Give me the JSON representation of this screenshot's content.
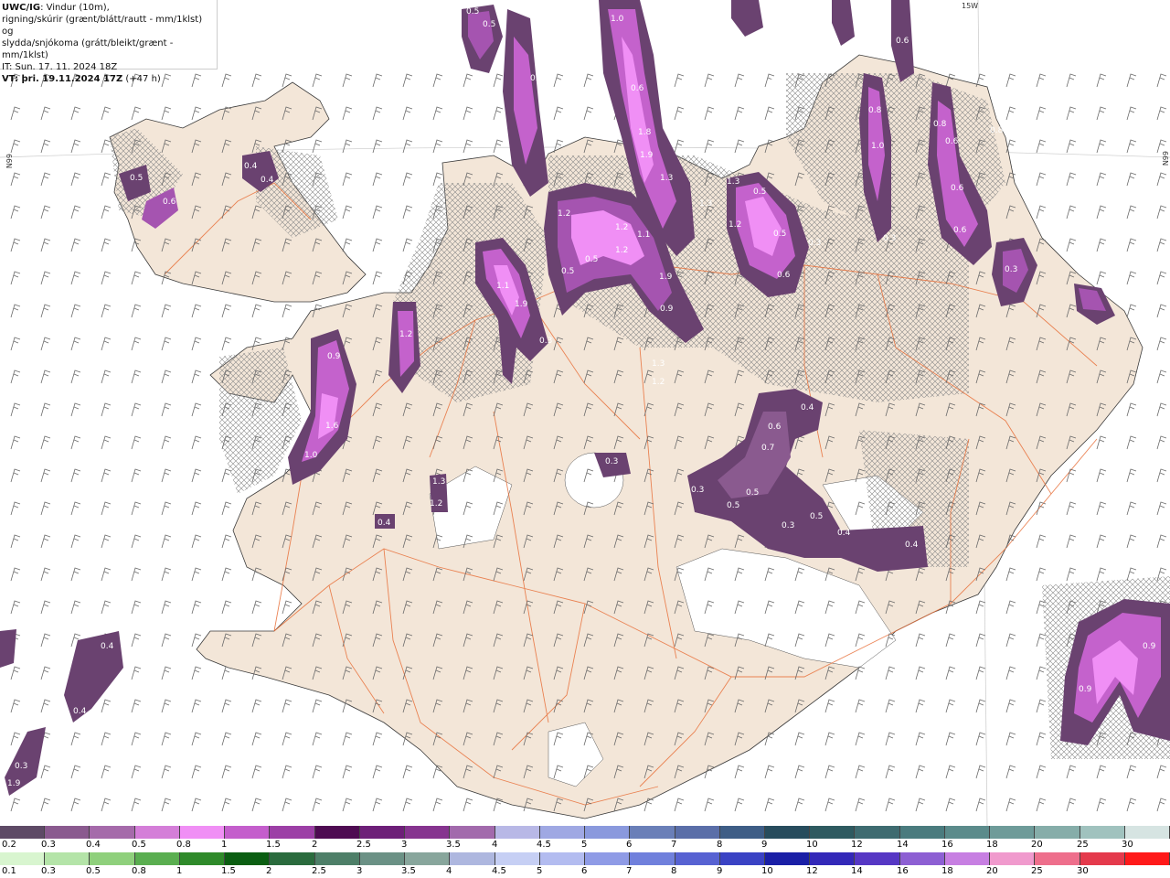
{
  "header": {
    "model": "UWC/IG",
    "line1_rest": ": Vindur (10m),",
    "line2": "rigning/skúrir (grænt/blátt/rautt - mm/1klst) og",
    "line3": "slydda/snjókoma (grátt/bleikt/grænt - mm/1klst)",
    "init": "IT: Sun. 17. 11. 2024 18Z",
    "valid": "VT: þri. 19.11.2024 17Z",
    "lead": "(+47 h)"
  },
  "map": {
    "edge_labels": {
      "top_lon": "15W",
      "left_lat": "66N",
      "right_lat": "66N"
    },
    "precip_values": [
      "0.5",
      "0.5",
      "1.0",
      "0.6",
      "0.4",
      "0.4",
      "0.6",
      "0.5",
      "0.6",
      "0.4",
      "0.4",
      "0.6",
      "0.8",
      "1.8",
      "1.9",
      "1.3",
      "1.3",
      "1.3",
      "0.5",
      "1.2",
      "0.5",
      "0.3",
      "0.6",
      "1.0",
      "0.8",
      "0.6",
      "0.8",
      "0.6",
      "0.3",
      "0.3",
      "0.6",
      "1.2",
      "1.1",
      "1.2",
      "0.5",
      "1.2",
      "0.5",
      "1.1",
      "1.9",
      "0.3",
      "1.9",
      "0.9",
      "1.2",
      "1.3",
      "1.2",
      "0.9",
      "1.6",
      "1.0",
      "1.3",
      "1.2",
      "0.4",
      "0.3",
      "0.4",
      "0.6",
      "0.7",
      "0.3",
      "0.5",
      "0.5",
      "0.3",
      "0.5",
      "0.4",
      "0.4",
      "0.4",
      "0.4",
      "0.3",
      "1.9",
      "0.9",
      "0.9"
    ],
    "colors": {
      "land": "#f3e6d8",
      "sea": "#ffffff",
      "roads": "#e8703a",
      "glacier": "#ffffff",
      "snow_hatch": "#8a8a8a"
    }
  },
  "legend": {
    "snow_labels": [
      "0.2",
      "0.3",
      "0.4",
      "0.5",
      "0.8",
      "1",
      "1.5",
      "2",
      "2.5",
      "3",
      "3.5",
      "4",
      "4.5",
      "5",
      "6",
      "7",
      "8",
      "9",
      "10",
      "12",
      "14",
      "16",
      "18",
      "20",
      "25",
      "30"
    ],
    "snow_colors": [
      "#5e4a66",
      "#8a5a8f",
      "#a56aaa",
      "#d47ed8",
      "#f08ff5",
      "#c45ecc",
      "#9c3fa6",
      "#4e0b52",
      "#6d1f78",
      "#86348f",
      "#a26aac",
      "#b8b8e6",
      "#9fa8e3",
      "#8a99dd",
      "#6a7fb8",
      "#5a6ea8",
      "#3e5d86",
      "#274c5d",
      "#2e5a60",
      "#3e6b70",
      "#4a7b7e",
      "#5b8b8b",
      "#6e9b99",
      "#86ada9",
      "#a0c2be",
      "#d6e4e2"
    ],
    "rain_labels": [
      "0.1",
      "0.3",
      "0.5",
      "0.8",
      "1",
      "1.5",
      "2",
      "2.5",
      "3",
      "3.5",
      "4",
      "4.5",
      "5",
      "6",
      "7",
      "8",
      "9",
      "10",
      "12",
      "14",
      "16",
      "18",
      "20",
      "25",
      "30"
    ],
    "rain_colors": [
      "#d8f5cf",
      "#b4e4a8",
      "#8fd07c",
      "#5aae50",
      "#2f8a2a",
      "#0b5e12",
      "#2a6b3d",
      "#4e7f68",
      "#6b9185",
      "#88a69c",
      "#aeb7df",
      "#c6cff4",
      "#b3bcf0",
      "#8f9be6",
      "#7080dc",
      "#5762d2",
      "#3a42c4",
      "#1a1fa6",
      "#3328b8",
      "#5637c4",
      "#8d5fd3",
      "#c77fe2",
      "#f09acd",
      "#ee6f8c",
      "#e43a4c"
    ],
    "rain_extra": "#ff1a1a"
  }
}
